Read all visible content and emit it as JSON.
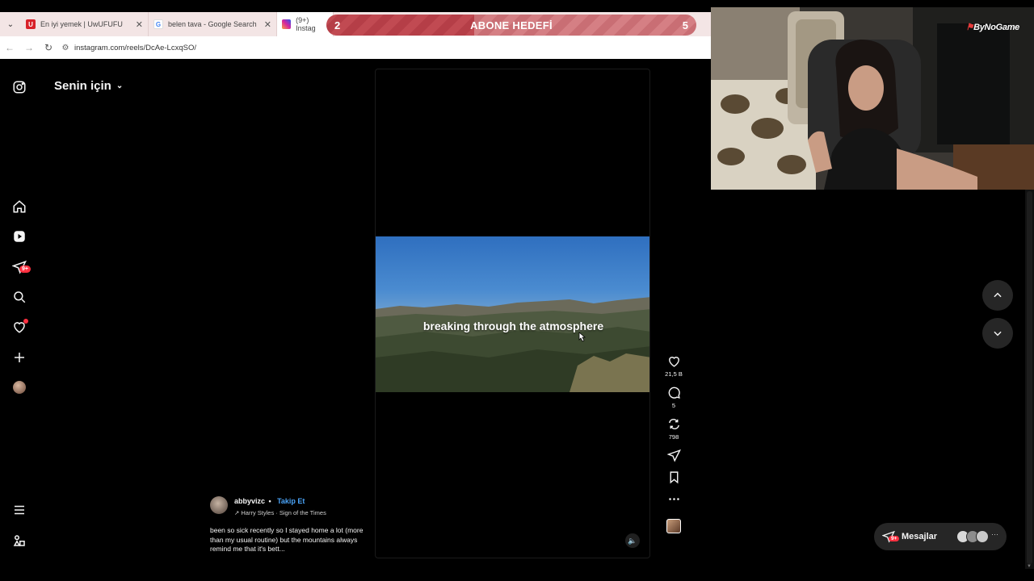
{
  "browser": {
    "tabs": [
      {
        "label": "En iyi yemek | UwUFUFU",
        "favicon": "U"
      },
      {
        "label": "belen tava - Google Search",
        "favicon": "G"
      },
      {
        "label": "(9+) Instag",
        "favicon": "instagram-icon"
      }
    ],
    "url": "instagram.com/reels/DcAe-LcxqSO/"
  },
  "goal": {
    "title": "ABONE HEDEFİ",
    "current": "2",
    "target": "5",
    "progress_fraction": 0.4
  },
  "sidebar": {
    "notifications_badge": "9+",
    "header_title": "Senin için"
  },
  "reel": {
    "overlay_text": "breaking through the atmosphere",
    "likes": "21,5 B",
    "comments": "5",
    "reposts": "798",
    "author": "abbyvizc",
    "separator": "•",
    "follow_label": "Takip Et",
    "music": "↗ Harry Styles · Sign of the Times",
    "description": "been so sick recently so I stayed home a lot (more than my usual routine) but the mountains always remind me that it's bett..."
  },
  "messages": {
    "label": "Mesajlar",
    "badge": "9+",
    "more": "···"
  },
  "webcam": {
    "brand": "ByNoGame"
  },
  "colors": {
    "accent_blue": "#4aa3f7",
    "badge_red": "#ff3040",
    "goal_fill": "#c14a52"
  }
}
